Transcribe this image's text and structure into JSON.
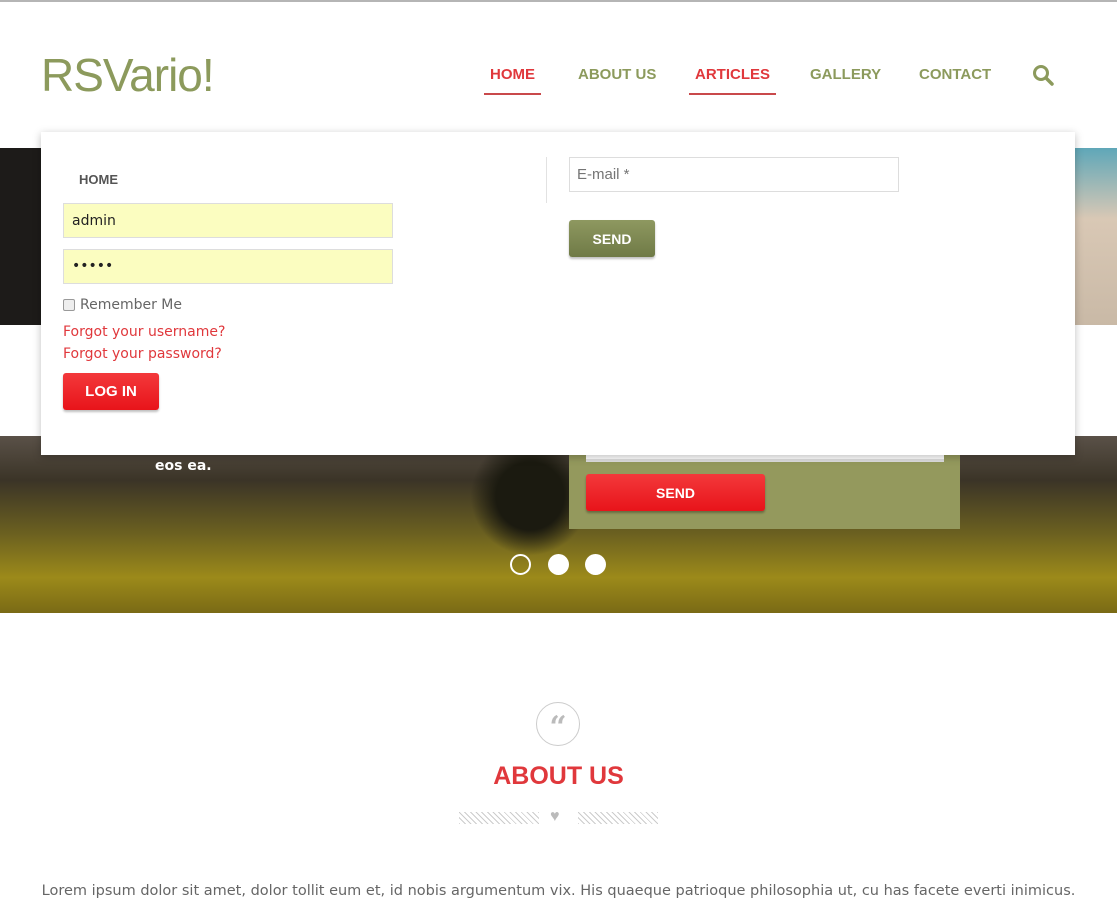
{
  "header": {
    "logo": "RSVario!",
    "nav": [
      {
        "label": "HOME",
        "active": true
      },
      {
        "label": "ABOUT US",
        "active": false
      },
      {
        "label": "ARTICLES",
        "active": true
      },
      {
        "label": "GALLERY",
        "active": false
      },
      {
        "label": "CONTACT",
        "active": false
      }
    ],
    "search_icon": "search-icon"
  },
  "login": {
    "title": "HOME",
    "username": "admin",
    "password": "•••••",
    "remember": "Remember Me",
    "forgot_username": "Forgot your username?",
    "forgot_password": "Forgot your password?",
    "login_label": "LOG IN"
  },
  "newsletter": {
    "email_placeholder": "E-mail *",
    "send_label": "SEND"
  },
  "hero": {
    "text": "eos ea.",
    "send_label": "SEND",
    "slides": 3,
    "active_slide": 1
  },
  "about": {
    "title": "ABOUT US",
    "icon": "quote-icon",
    "text": "Lorem ipsum dolor sit amet, dolor tollit eum et, id nobis argumentum vix. His quaeque patrioque philosophia ut, cu has facete everti inimicus."
  },
  "colors": {
    "brand": "#8c9a5c",
    "accent": "#e0383c"
  }
}
